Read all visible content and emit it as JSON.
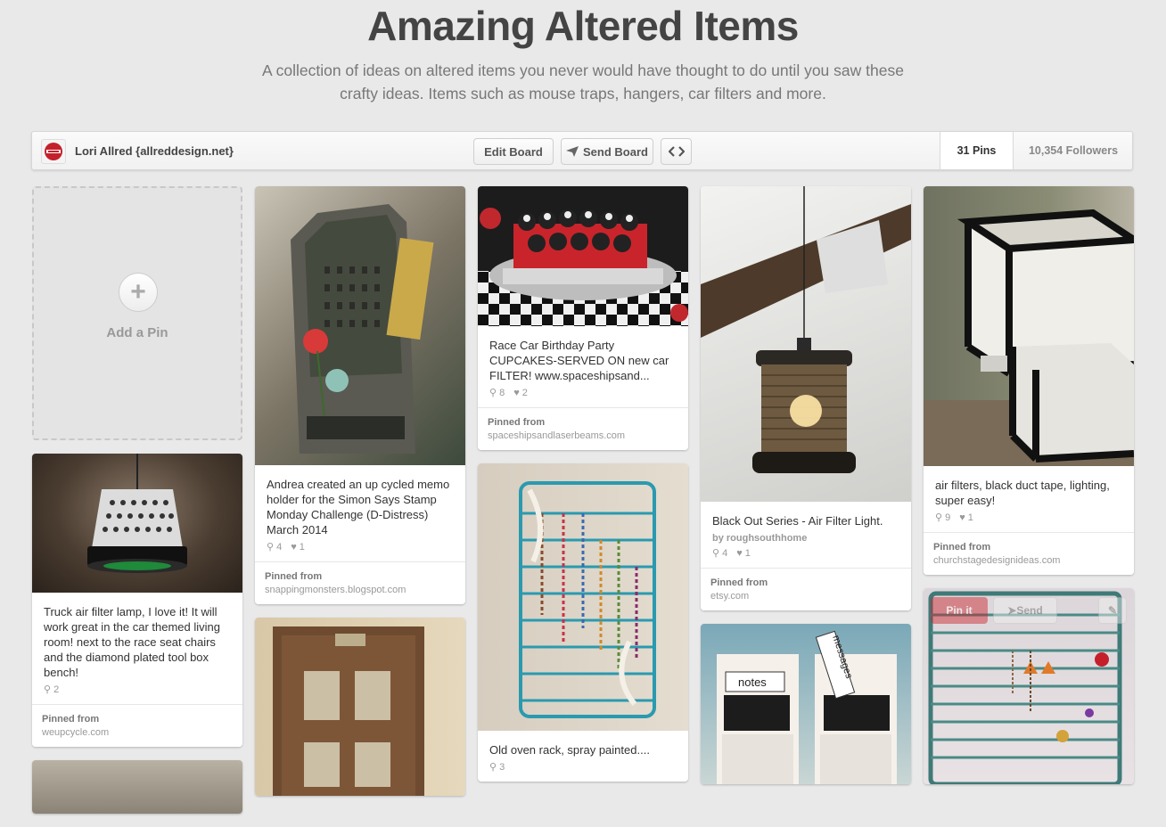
{
  "board": {
    "title": "Amazing Altered Items",
    "description": "A collection of ideas on altered items you never would have thought to do until you saw these crafty ideas. Items such as mouse traps, hangers, car filters and more."
  },
  "bar": {
    "owner": "Lori Allred {allreddesign.net}",
    "edit_label": "Edit Board",
    "send_label": "Send Board",
    "embed_glyph": "<>",
    "pins_count": "31 Pins",
    "followers_count": "10,354 Followers"
  },
  "add_pin": {
    "label": "Add a Pin",
    "plus": "+"
  },
  "source_label": "Pinned from",
  "pins": [
    {
      "desc": "Truck air filter lamp, I love it! It will work great in the car themed living room! next to the race seat chairs and the diamond plated tool box bench!",
      "repins": "2",
      "source": "weupcycle.com"
    },
    {
      "desc": "Andrea created an up cycled memo holder for the Simon Says Stamp Monday Challenge (D-Distress) March 2014",
      "repins": "4",
      "likes": "1",
      "source": "snappingmonsters.blogspot.com"
    },
    {
      "desc": "Race Car Birthday Party CUPCAKES-SERVED ON new car FILTER! www.spaceshipsand...",
      "repins": "8",
      "likes": "2",
      "source": "spaceshipsandlaserbeams.com"
    },
    {
      "desc": "Old oven rack, spray painted....",
      "repins": "3"
    },
    {
      "desc": "Black Out Series - Air Filter Light.",
      "credit": "by roughsouthhome",
      "repins": "4",
      "likes": "1",
      "source": "etsy.com"
    },
    {
      "desc": "air filters, black duct tape, lighting, super easy!",
      "repins": "9",
      "likes": "1",
      "source": "churchstagedesignideas.com"
    }
  ],
  "hover": {
    "pin_it": "Pin it",
    "send": "Send"
  },
  "image_text": {
    "notes": "notes",
    "messages": "messages"
  },
  "colors": {
    "background": "#e9e9e9",
    "pin_red": "#cb2027",
    "rack_teal": "#2a9ab0"
  }
}
